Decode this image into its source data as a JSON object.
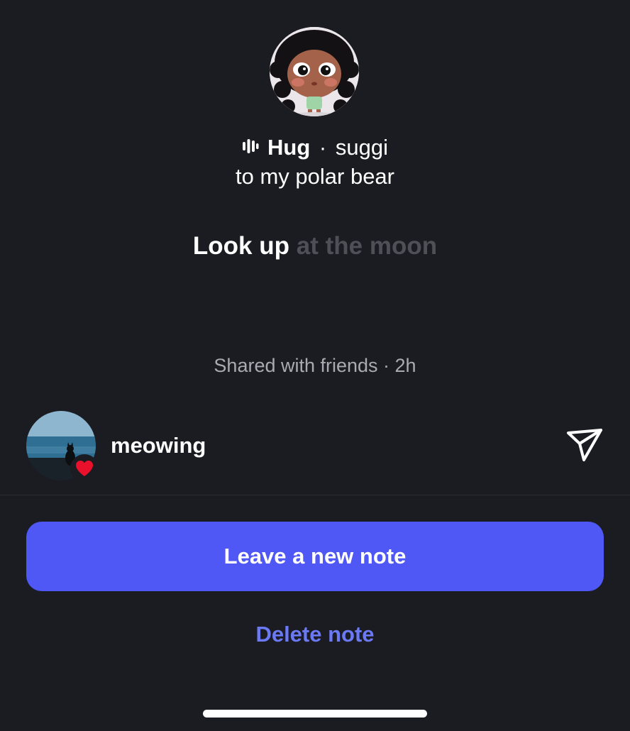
{
  "note": {
    "song_title": "Hug",
    "separator": "·",
    "artist": "suggi",
    "caption": "to my polar bear",
    "lyric_active": "Look up",
    "lyric_inactive": "at the moon",
    "shared_meta": "Shared with friends · 2h"
  },
  "reaction": {
    "username": "meowing",
    "reaction_icon": "heart-icon"
  },
  "actions": {
    "primary_label": "Leave a new note",
    "secondary_label": "Delete note"
  },
  "colors": {
    "background": "#1b1c22",
    "primary_button": "#4f57f5",
    "secondary_text": "#6b79f5",
    "muted_text": "#a9abb2",
    "heart": "#e8102a"
  }
}
